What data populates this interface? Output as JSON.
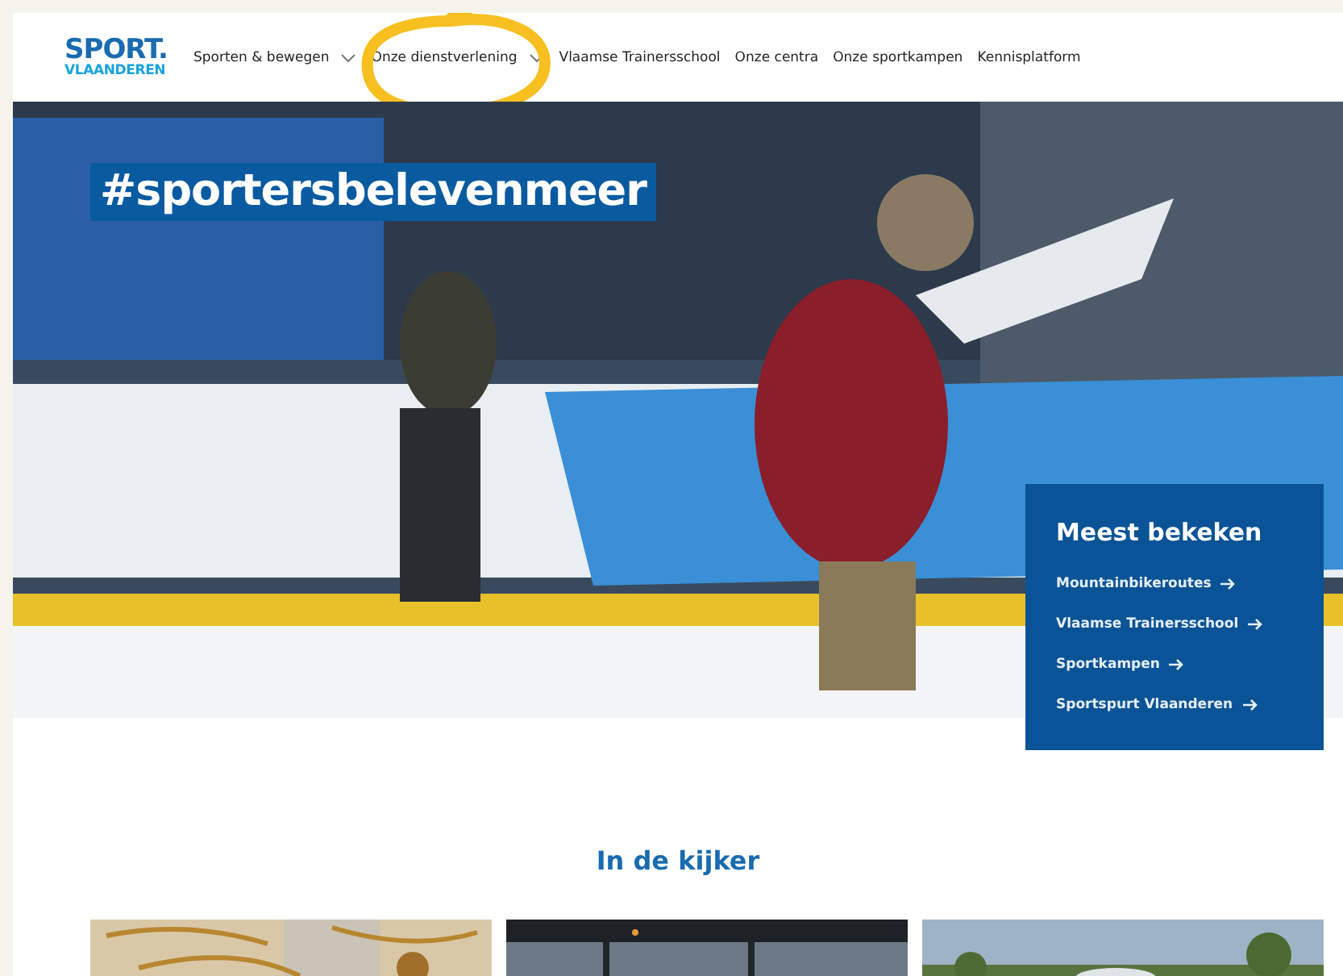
{
  "logo": {
    "line1": "SPORT.",
    "line2": "VLAANDEREN"
  },
  "nav": [
    {
      "label": "Sporten & bewegen",
      "dropdown": true,
      "circled": false
    },
    {
      "label": "Onze dienstverlening",
      "dropdown": true,
      "circled": true
    },
    {
      "label": "Vlaamse Trainersschool",
      "dropdown": false,
      "circled": false
    },
    {
      "label": "Onze centra",
      "dropdown": false,
      "circled": false
    },
    {
      "label": "Onze sportkampen",
      "dropdown": false,
      "circled": false
    },
    {
      "label": "Kennisplatform",
      "dropdown": false,
      "circled": false
    }
  ],
  "hero": {
    "hashtag": "#sportersbelevenmeer",
    "kind": "picture"
  },
  "most_viewed": {
    "title": "Meest bekeken",
    "links": [
      "Mountainbikeroutes",
      "Vlaamse Trainersschool",
      "Sportkampen",
      "Sportspurt Vlaanderen"
    ]
  },
  "featured": {
    "title": "In de kijker"
  }
}
